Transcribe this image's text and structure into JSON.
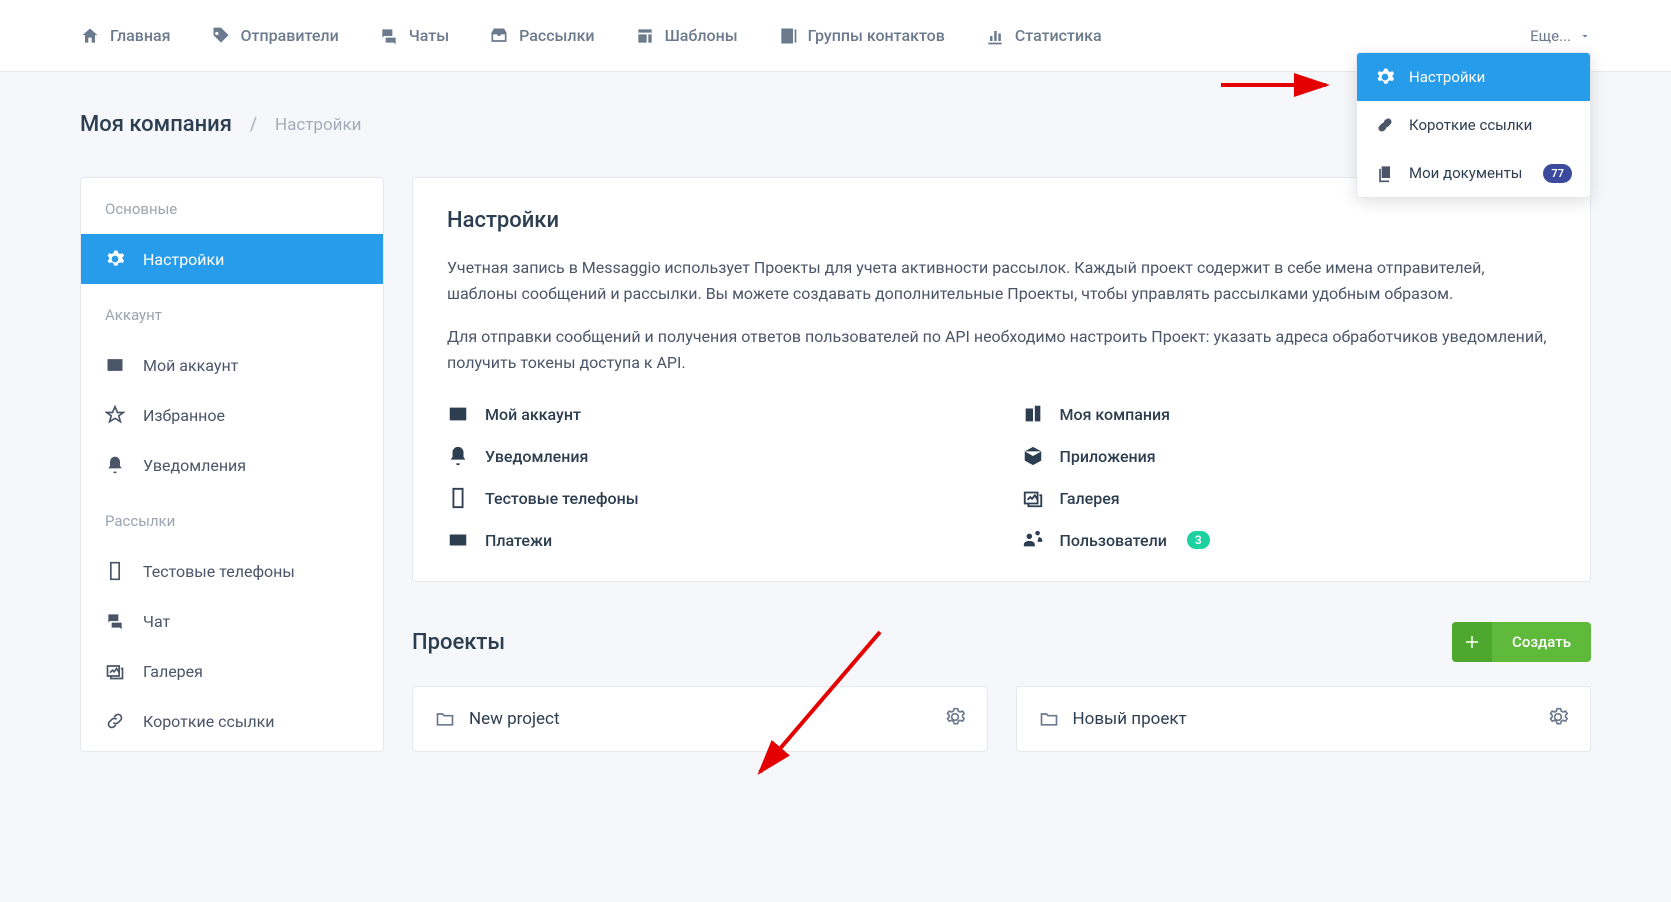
{
  "nav": {
    "items": [
      {
        "label": "Главная"
      },
      {
        "label": "Отправители"
      },
      {
        "label": "Чаты"
      },
      {
        "label": "Рассылки"
      },
      {
        "label": "Шаблоны"
      },
      {
        "label": "Группы контактов"
      },
      {
        "label": "Статистика"
      }
    ],
    "more": "Еще..."
  },
  "breadcrumb": {
    "root": "Моя компания",
    "current": "Настройки"
  },
  "sidebar": {
    "sections": [
      {
        "title": "Основные",
        "items": [
          {
            "label": "Настройки",
            "active": true
          }
        ]
      },
      {
        "title": "Аккаунт",
        "items": [
          {
            "label": "Мой аккаунт"
          },
          {
            "label": "Избранное"
          },
          {
            "label": "Уведомления"
          }
        ]
      },
      {
        "title": "Рассылки",
        "items": [
          {
            "label": "Тестовые телефоны"
          },
          {
            "label": "Чат"
          },
          {
            "label": "Галерея"
          },
          {
            "label": "Короткие ссылки"
          }
        ]
      }
    ]
  },
  "settings_panel": {
    "title": "Настройки",
    "para1": "Учетная запись в Messaggio использует Проекты для учета активности рассылок. Каждый проект содержит в себе имена отправителей, шаблоны сообщений и рассылки. Вы можете создавать дополнительные Проекты, чтобы управлять рассылками удобным образом.",
    "para2": "Для отправки сообщений и получения ответов пользователей по API необходимо настроить Проект: указать адреса обработчиков уведомлений, получить токены доступа к API.",
    "grid": {
      "left": [
        {
          "label": "Мой аккаунт"
        },
        {
          "label": "Уведомления"
        },
        {
          "label": "Тестовые телефоны"
        },
        {
          "label": "Платежи"
        }
      ],
      "right": [
        {
          "label": "Моя компания"
        },
        {
          "label": "Приложения"
        },
        {
          "label": "Галерея"
        },
        {
          "label": "Пользователи",
          "badge": "3"
        }
      ]
    }
  },
  "projects": {
    "title": "Проекты",
    "create_label": "Создать",
    "cards": [
      {
        "name": "New project"
      },
      {
        "name": "Новый проект"
      }
    ]
  },
  "dropdown": {
    "items": [
      {
        "label": "Настройки",
        "active": true
      },
      {
        "label": "Короткие ссылки"
      },
      {
        "label": "Мои документы",
        "badge": "77"
      }
    ]
  }
}
